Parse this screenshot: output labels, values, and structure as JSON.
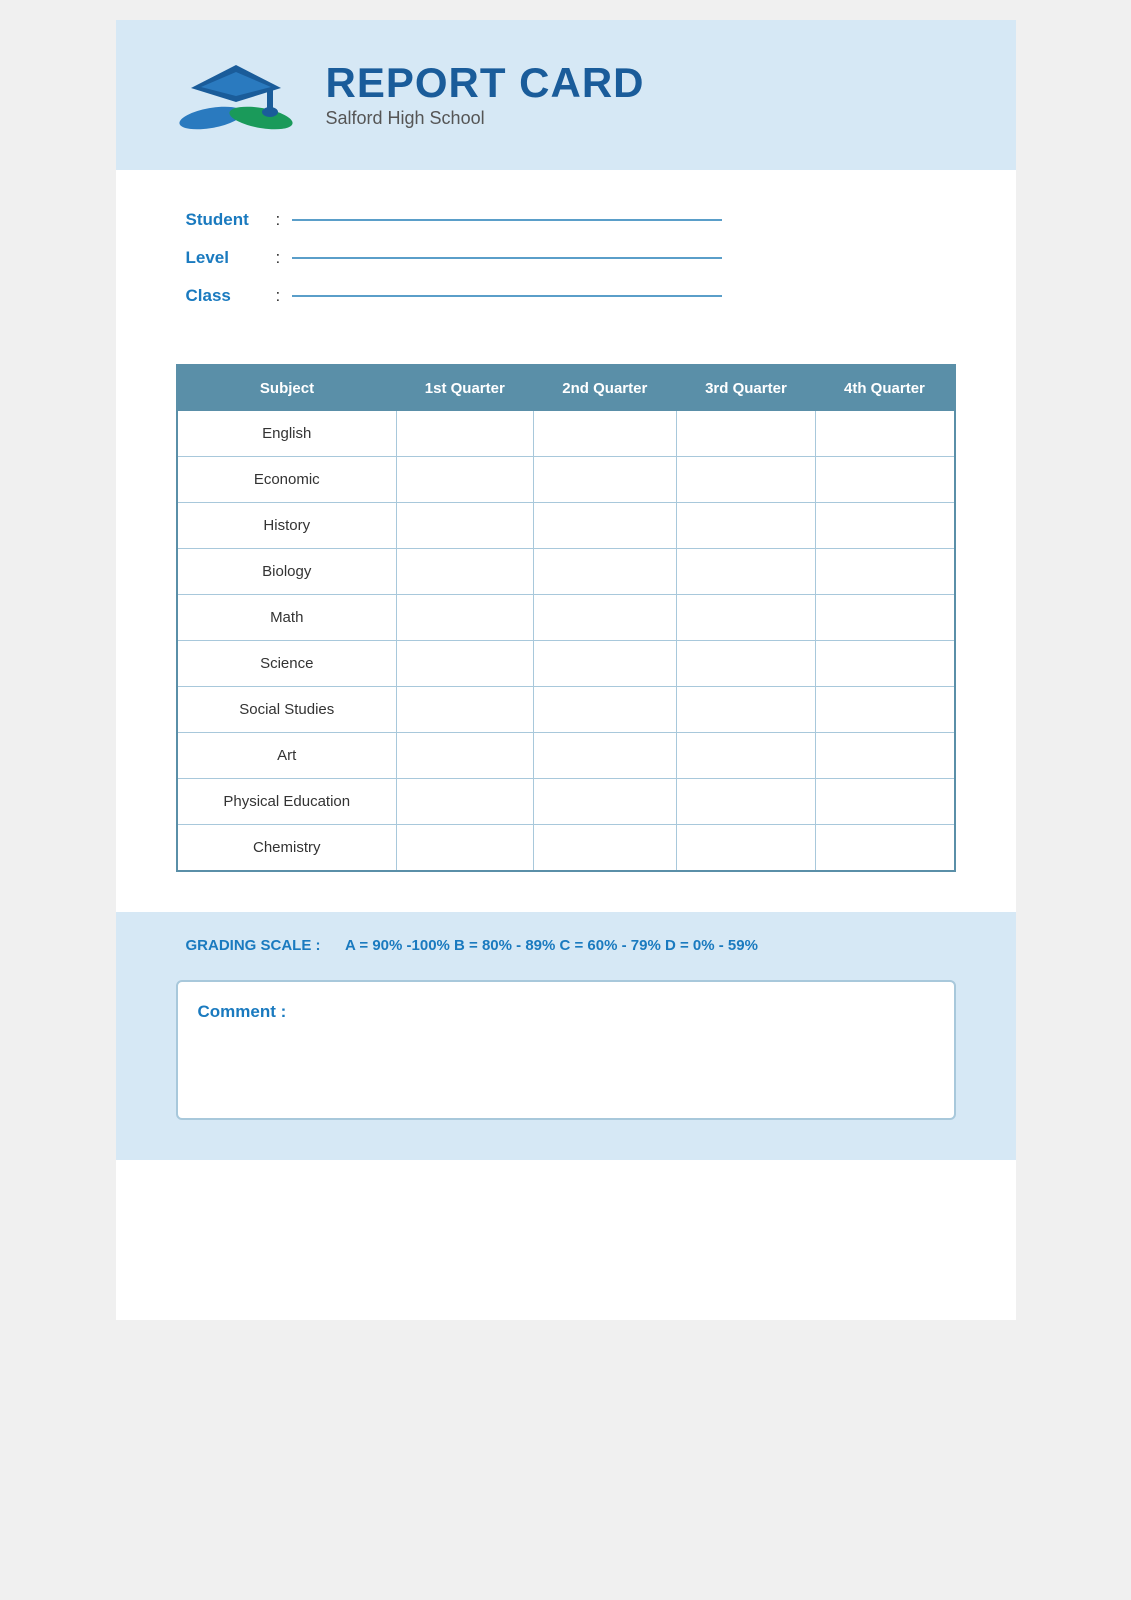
{
  "header": {
    "title": "REPORT CARD",
    "subtitle": "Salford High School"
  },
  "student_info": {
    "student_label": "Student",
    "level_label": "Level",
    "class_label": "Class",
    "colon": ":"
  },
  "table": {
    "headers": {
      "subject": "Subject",
      "q1": "1st Quarter",
      "q2": "2nd Quarter",
      "q3": "3rd Quarter",
      "q4": "4th Quarter"
    },
    "subjects": [
      "English",
      "Economic",
      "History",
      "Biology",
      "Math",
      "Science",
      "Social Studies",
      "Art",
      "Physical Education",
      "Chemistry"
    ]
  },
  "grading": {
    "label": "GRADING SCALE :",
    "scale": "A = 90% -100%  B = 80% - 89%  C = 60% - 79%  D = 0% - 59%"
  },
  "comment": {
    "label": "Comment :"
  },
  "colors": {
    "header_bg": "#d6e8f5",
    "table_header_bg": "#5a8fa8",
    "accent_blue": "#1a7abf",
    "dark_blue": "#1a5c9a"
  }
}
